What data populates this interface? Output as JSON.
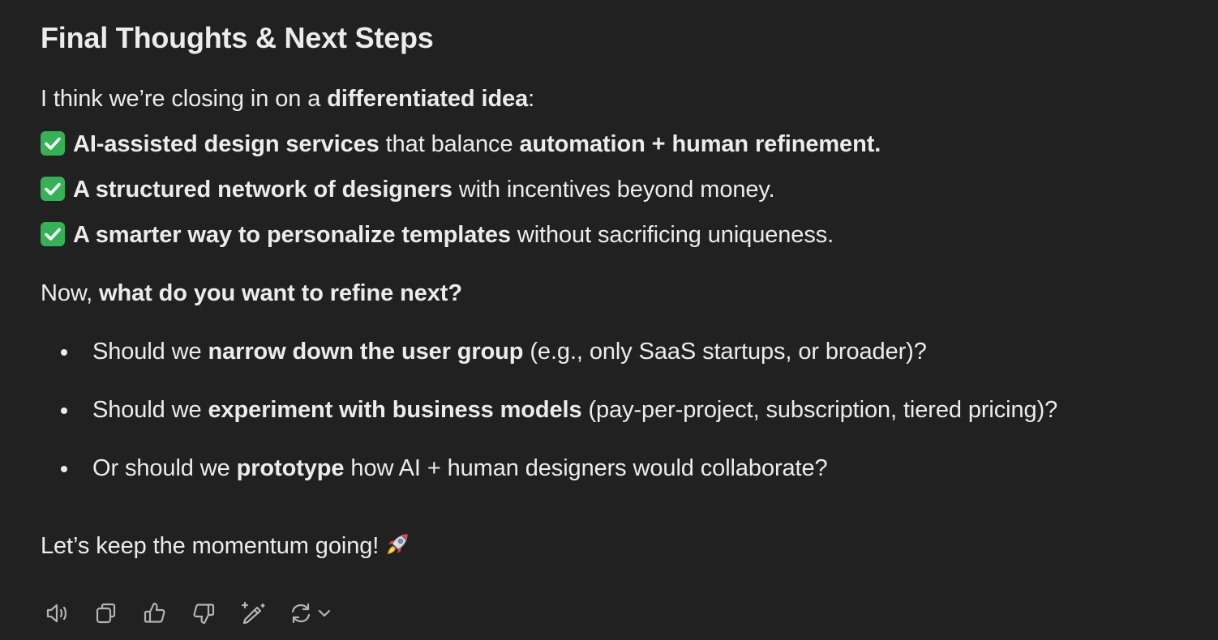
{
  "heading": "Final Thoughts & Next Steps",
  "intro": {
    "prefix": "I think we’re closing in on a ",
    "bold": "differentiated idea",
    "suffix": ":"
  },
  "checklist": [
    {
      "icon": "check-mark-button-icon",
      "bold1": "AI-assisted design services",
      "text": " that balance ",
      "bold2": "automation + human refinement."
    },
    {
      "icon": "check-mark-button-icon",
      "bold1": "A structured network of designers",
      "text": " with incentives beyond money.",
      "bold2": ""
    },
    {
      "icon": "check-mark-button-icon",
      "bold1": "A smarter way to personalize templates",
      "text": " without sacrificing uniqueness.",
      "bold2": ""
    }
  ],
  "question": {
    "prefix": "Now, ",
    "bold": "what do you want to refine next?"
  },
  "bullets": [
    {
      "prefix": "Should we ",
      "bold": "narrow down the user group",
      "suffix": " (e.g., only SaaS startups, or broader)?"
    },
    {
      "prefix": "Should we ",
      "bold": "experiment with business models",
      "suffix": " (pay-per-project, subscription, tiered pricing)?"
    },
    {
      "prefix": "Or should we ",
      "bold": "prototype",
      "suffix": " how AI + human designers would collaborate?"
    }
  ],
  "closing": {
    "text": "Let’s keep the momentum going!",
    "emoji_icon": "rocket-icon"
  },
  "toolbar": {
    "icons": [
      "read-aloud-icon",
      "copy-icon",
      "thumbs-up-icon",
      "thumbs-down-icon",
      "edit-canvas-icon",
      "regenerate-icon",
      "chevron-down-icon"
    ]
  },
  "colors": {
    "background": "#212121",
    "text": "#ececec",
    "check_green": "#35b255",
    "icon": "#b4b4b4"
  }
}
